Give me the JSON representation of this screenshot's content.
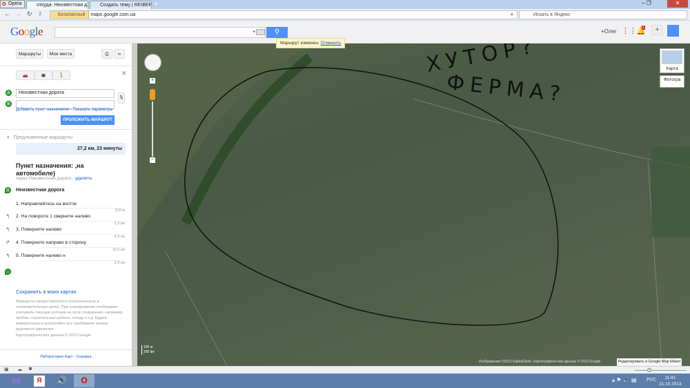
{
  "browser": {
    "menu_label": "Opera",
    "tabs": [
      {
        "label": "откуда: Неизвестная д..."
      },
      {
        "label": "Создать тему | REIBER..."
      }
    ],
    "security_label": "Безопасный",
    "url": "maps.google.com.ua",
    "search_placeholder": "Искать в Яндекс"
  },
  "header": {
    "logo": "Google",
    "user": "+Олег",
    "notif_count": "1"
  },
  "toast": {
    "text": "Маршрут изменен.",
    "undo": "Отменить"
  },
  "panel": {
    "tab_routes": "Маршруты",
    "tab_places": "Мои места",
    "from": "Неизвестная дорога",
    "to": "",
    "from_marker": "A",
    "to_marker": "B",
    "add_dest": "Добавить пункт назначения",
    "show_params": "Показать параметры",
    "build_route": "ПРОЛОЖИТЬ МАРШРУТ",
    "suggested": "Предложенные маршруты",
    "route_summary": "27,2 км, 23 минуты",
    "dest_title": "Пункт назначения:            ,на автомобиле)",
    "via": "через Неизвестная дорога -",
    "delete": "удалить",
    "start_name": "Неизвестная дорога",
    "steps": [
      {
        "text": "1. Направляйтесь на восток",
        "dist": "210 м"
      },
      {
        "text": "2. На повороте 1 сверните налево",
        "dist": "1,9 км"
      },
      {
        "text": "3. Поверните налево",
        "dist": "5,8 км"
      },
      {
        "text": "4. Поверните направо в сторону",
        "dist": "16,5 км"
      },
      {
        "text": "5. Поверните налево н",
        "dist": "2,8 км"
      }
    ],
    "save": "Сохранить в моих картах",
    "disclaimer": "Маршруты предоставляются исключительно в ознакомительных целях. При планировании необходимо учитывать текущие условия на пути следования, например пробки, строительные работы, погоду и т.д. Будьте внимательны и выполняйте все требования знаков дорожного движения.",
    "map_data": "Картографические данные © 2013 Google",
    "footer": "Лаборатория Карт - Справка"
  },
  "map": {
    "type_map": "Карта",
    "type_photo": "Фотогра",
    "scale_m": "100 м",
    "scale_ft": "200 фт",
    "attribution": "Изображения ©2013 DigitalGlobe, Картографические данные © 2013 Google",
    "edit": "Редактировать в Google Map Maker",
    "annot1": "ХУТОР?",
    "annot2": "ФЕРМА?"
  },
  "taskbar": {
    "lang": "РУС",
    "time": "11:41",
    "date": "21.10.2013"
  }
}
